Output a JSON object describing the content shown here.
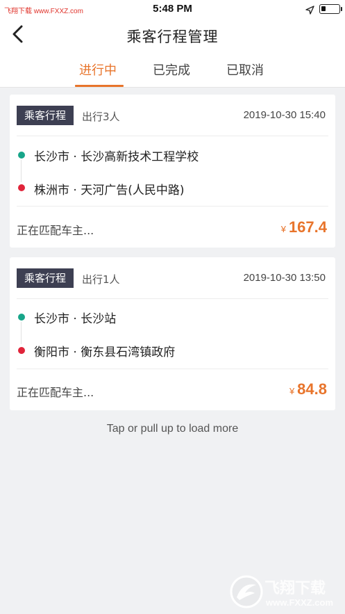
{
  "status_bar": {
    "carrier": "飞翔下载 www.FXXZ.com",
    "time": "5:48 PM",
    "battery_level": 0.25
  },
  "nav": {
    "title": "乘客行程管理",
    "back_icon": "chevron-left-icon"
  },
  "tabs": [
    {
      "label": "进行中",
      "active": true
    },
    {
      "label": "已完成",
      "active": false
    },
    {
      "label": "已取消",
      "active": false
    }
  ],
  "trips": [
    {
      "tag": "乘客行程",
      "persons": "出行3人",
      "datetime": "2019-10-30 15:40",
      "from": "长沙市 · 长沙高新技术工程学校",
      "to": "株洲市 · 天河广告(人民中路)",
      "status": "正在匹配车主...",
      "currency": "¥",
      "price": "167.4"
    },
    {
      "tag": "乘客行程",
      "persons": "出行1人",
      "datetime": "2019-10-30 13:50",
      "from": "长沙市 · 长沙站",
      "to": "衡阳市 · 衡东县石湾镇政府",
      "status": "正在匹配车主...",
      "currency": "¥",
      "price": "84.8"
    }
  ],
  "load_more": "Tap or pull up to load more",
  "watermark": {
    "brand": "飞翔下载",
    "url": "www.FXXZ.com"
  },
  "colors": {
    "accent": "#e8742b",
    "tag_bg": "#3d3f52",
    "from_dot": "#17a589",
    "to_dot": "#e0243a"
  }
}
